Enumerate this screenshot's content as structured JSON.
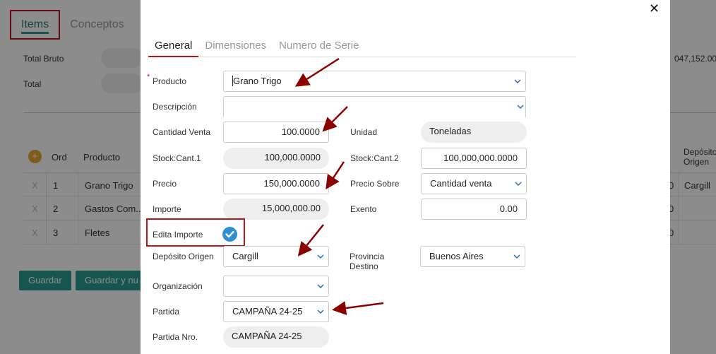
{
  "background": {
    "tabs": [
      {
        "label": "Items",
        "active": true
      },
      {
        "label": "Conceptos",
        "active": false
      }
    ],
    "total_bruto_label": "Total Bruto",
    "total_label": "Total",
    "total_bruto_value_partial": "047,152.00",
    "table": {
      "headers": [
        "Ord",
        "Producto"
      ],
      "right_header": "Depósito Origen",
      "rows": [
        {
          "ord": "1",
          "producto": "Grano Trigo",
          "right_partial": "0",
          "deposito": "Cargill"
        },
        {
          "ord": "2",
          "producto": "Gastos Com...",
          "right_partial": "0",
          "deposito": ""
        },
        {
          "ord": "3",
          "producto": "Fletes",
          "right_partial": "0",
          "deposito": ""
        }
      ],
      "remove_glyph": "X"
    },
    "buttons": {
      "guardar": "Guardar",
      "guardar_y_nuevo_partial": "Guardar y nu"
    }
  },
  "modal": {
    "close_glyph": "✕",
    "tabs": [
      {
        "label": "General",
        "active": true
      },
      {
        "label": "Dimensiones",
        "active": false
      },
      {
        "label": "Numero de Serie",
        "active": false
      }
    ],
    "required_mark": "*",
    "fields": {
      "producto": {
        "label": "Producto",
        "value": "Grano Trigo"
      },
      "descripcion": {
        "label": "Descripción",
        "value": ""
      },
      "cantidad_venta": {
        "label": "Cantidad Venta",
        "value": "100.0000"
      },
      "unidad": {
        "label": "Unidad",
        "value": "Toneladas"
      },
      "stock_cant1": {
        "label": "Stock:Cant.1",
        "value": "100,000.0000"
      },
      "stock_cant2": {
        "label": "Stock:Cant.2",
        "value": "100,000,000.0000"
      },
      "precio": {
        "label": "Precio",
        "value": "150,000.0000"
      },
      "precio_sobre": {
        "label": "Precio Sobre",
        "value": "Cantidad venta"
      },
      "importe": {
        "label": "Importe",
        "value": "15,000,000.00"
      },
      "exento": {
        "label": "Exento",
        "value": "0.00"
      },
      "edita_importe": {
        "label": "Edita Importe",
        "checked": true
      },
      "deposito_origen": {
        "label": "Depósito Origen",
        "value": "Cargill"
      },
      "provincia_destino": {
        "label_line1": "Provincia",
        "label_line2": "Destino",
        "value": "Buenos Aires"
      },
      "organizacion": {
        "label": "Organización",
        "value": ""
      },
      "partida": {
        "label": "Partida",
        "value": "CAMPAÑA 24-25"
      },
      "partida_nro": {
        "label": "Partida Nro.",
        "value": "CAMPAÑA 24-25"
      }
    }
  },
  "colors": {
    "accent": "#2a9d8f",
    "annotation": "#8b0000",
    "highlight_border": "#c0131a",
    "checkbox": "#2e8fd5",
    "dropdown_chevron": "#2a6fb7"
  },
  "icons": [
    "close-icon",
    "chevron-down-icon",
    "check-icon",
    "add-icon",
    "remove-icon",
    "annotation-arrow-icon"
  ]
}
